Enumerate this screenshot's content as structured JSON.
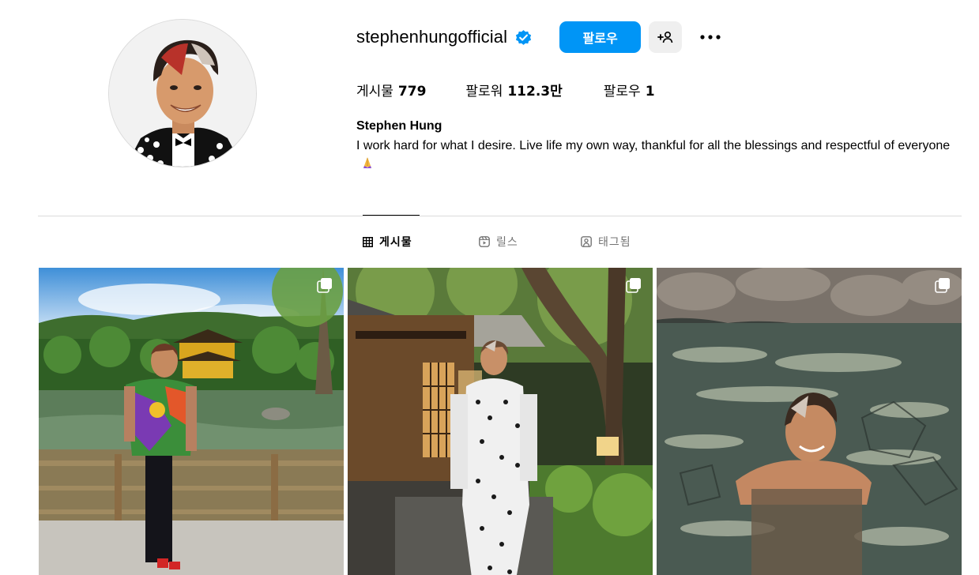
{
  "profile": {
    "username": "stephenhungofficial",
    "verified_icon": "verified-badge-icon",
    "follow_label": "팔로우",
    "suggest_icon": "add-person-icon",
    "more_icon": "more-options-icon",
    "full_name": "Stephen Hung",
    "bio": "I work hard for what I desire. Live life my own way, thankful for all the blessings and respectful of everyone",
    "bio_emoji": "praying-hands-emoji"
  },
  "stats": {
    "posts_label": "게시물",
    "posts_value": "779",
    "followers_label": "팔로워",
    "followers_value": "112.3만",
    "following_label": "팔로우",
    "following_value": "1"
  },
  "tabs": {
    "posts": "게시물",
    "reels": "릴스",
    "tagged": "태그됨"
  },
  "grid": {
    "tiles": [
      {
        "name": "post-golden-pavilion",
        "carousel": true
      },
      {
        "name": "post-garden-suit",
        "carousel": true
      },
      {
        "name": "post-hot-spring",
        "carousel": true
      }
    ]
  },
  "colors": {
    "accent": "#0095f6",
    "secondary_button": "#efefef",
    "muted_text": "#737373",
    "divider": "#dbdbdb"
  }
}
